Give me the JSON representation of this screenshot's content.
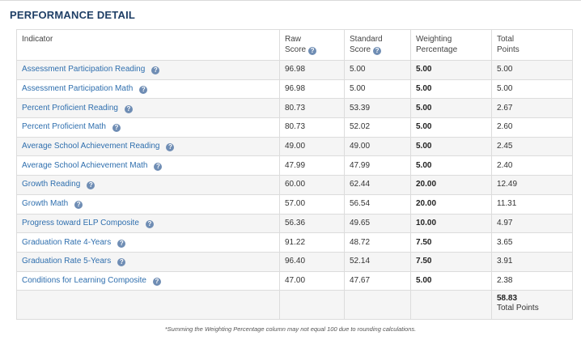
{
  "section": {
    "title": "PERFORMANCE DETAIL"
  },
  "headers": {
    "indicator": "Indicator",
    "raw_line1": "Raw",
    "raw_line2": "Score",
    "std_line1": "Standard",
    "std_line2": "Score",
    "weight_line1": "Weighting",
    "weight_line2": "Percentage",
    "total_line1": "Total",
    "total_line2": "Points"
  },
  "help_icon": {
    "glyph": "?",
    "icon": "question-circle-icon"
  },
  "rows": [
    {
      "indicator": "Assessment Participation Reading",
      "raw": "96.98",
      "standard": "5.00",
      "weight": "5.00",
      "total": "5.00"
    },
    {
      "indicator": "Assessment Participation Math",
      "raw": "96.98",
      "standard": "5.00",
      "weight": "5.00",
      "total": "5.00"
    },
    {
      "indicator": "Percent Proficient Reading",
      "raw": "80.73",
      "standard": "53.39",
      "weight": "5.00",
      "total": "2.67"
    },
    {
      "indicator": "Percent Proficient Math",
      "raw": "80.73",
      "standard": "52.02",
      "weight": "5.00",
      "total": "2.60"
    },
    {
      "indicator": "Average School Achievement Reading",
      "raw": "49.00",
      "standard": "49.00",
      "weight": "5.00",
      "total": "2.45"
    },
    {
      "indicator": "Average School Achievement Math",
      "raw": "47.99",
      "standard": "47.99",
      "weight": "5.00",
      "total": "2.40"
    },
    {
      "indicator": "Growth Reading",
      "raw": "60.00",
      "standard": "62.44",
      "weight": "20.00",
      "total": "12.49"
    },
    {
      "indicator": "Growth Math",
      "raw": "57.00",
      "standard": "56.54",
      "weight": "20.00",
      "total": "11.31"
    },
    {
      "indicator": "Progress toward ELP Composite",
      "raw": "56.36",
      "standard": "49.65",
      "weight": "10.00",
      "total": "4.97"
    },
    {
      "indicator": "Graduation Rate 4-Years",
      "raw": "91.22",
      "standard": "48.72",
      "weight": "7.50",
      "total": "3.65"
    },
    {
      "indicator": "Graduation Rate 5-Years",
      "raw": "96.40",
      "standard": "52.14",
      "weight": "7.50",
      "total": "3.91"
    },
    {
      "indicator": "Conditions for Learning Composite",
      "raw": "47.00",
      "standard": "47.67",
      "weight": "5.00",
      "total": "2.38"
    }
  ],
  "totals": {
    "value": "58.83",
    "label": "Total Points"
  },
  "footnote": "*Summing the Weighting Percentage column may not equal 100 due to rounding calculations.",
  "colors": {
    "title": "#1f3f66",
    "link": "#2f6fae",
    "help_icon": "#6f8db4",
    "stripe": "#f5f5f5",
    "border": "#dcdcdc"
  }
}
